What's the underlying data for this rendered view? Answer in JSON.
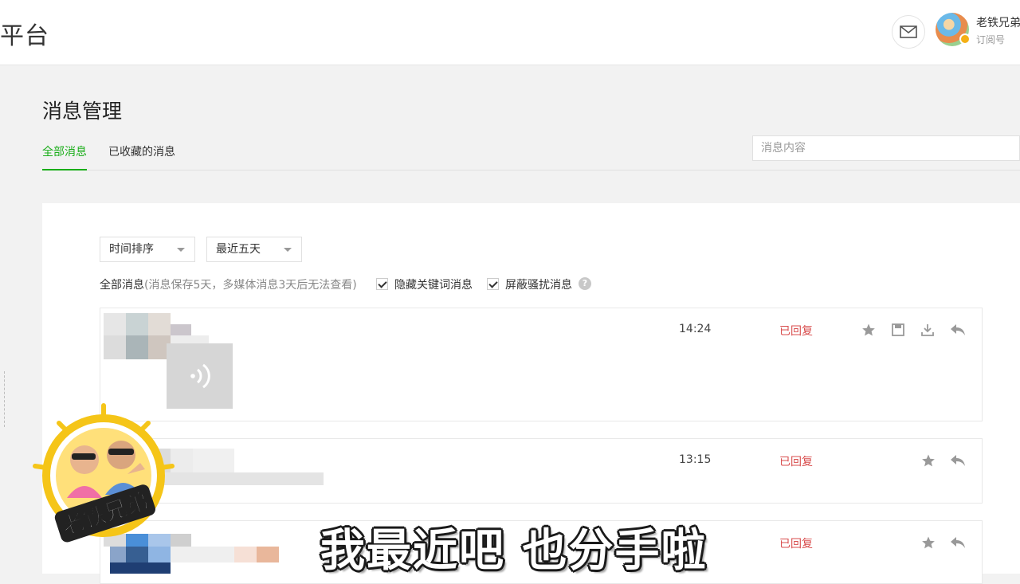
{
  "header": {
    "brand_title": "平台",
    "mail_icon": "mail-icon",
    "account_name": "老铁兄弟",
    "account_type": "订阅号"
  },
  "page": {
    "title": "消息管理",
    "tabs": [
      {
        "label": "全部消息",
        "active": true
      },
      {
        "label": "已收藏的消息",
        "active": false
      }
    ],
    "search_placeholder": "消息内容"
  },
  "filters": {
    "sort_value": "时间排序",
    "range_value": "最近五天",
    "summary_label": "全部消息",
    "summary_note": "(消息保存5天，多媒体消息3天后无法查看)",
    "hide_keyword_label": "隐藏关键词消息",
    "hide_keyword_checked": true,
    "block_spam_label": "屏蔽骚扰消息",
    "block_spam_checked": true,
    "help_glyph": "?"
  },
  "messages": [
    {
      "time": "14:24",
      "status": "已回复",
      "actions": [
        "star-icon",
        "save-icon",
        "download-icon",
        "reply-icon"
      ],
      "content_type": "voice"
    },
    {
      "time": "13:15",
      "status": "已回复",
      "actions": [
        "star-icon",
        "reply-icon"
      ],
      "content_type": "text"
    },
    {
      "time": "1",
      "status": "已回复",
      "actions": [
        "star-icon",
        "reply-icon"
      ],
      "content_type": "text"
    }
  ],
  "overlay": {
    "mascot_text": "老铁兄弟",
    "subtitle": "我最近吧 也分手啦"
  },
  "colors": {
    "accent_green": "#1aad19",
    "status_red": "#d84c4c",
    "mascot_yellow": "#f5c518"
  }
}
